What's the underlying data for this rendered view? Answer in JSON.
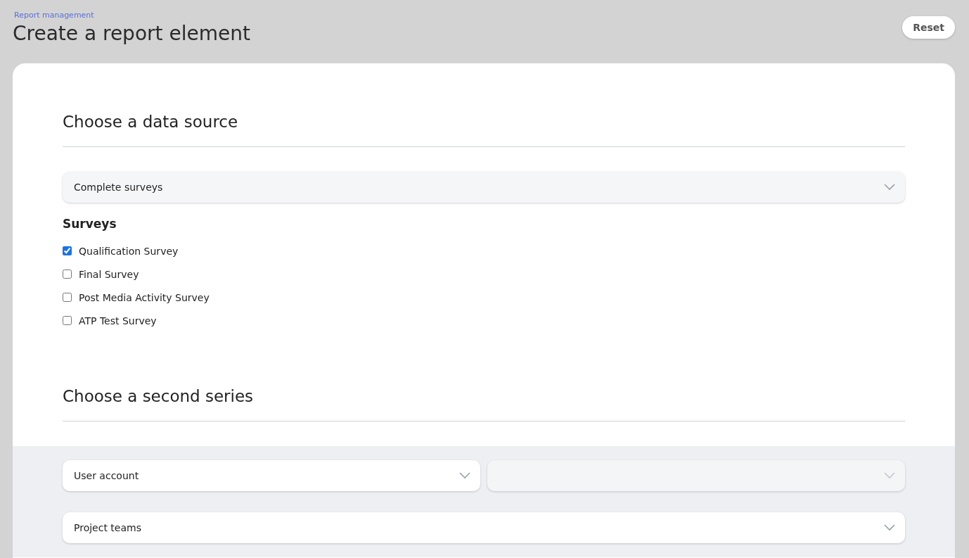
{
  "breadcrumb": "Report management",
  "title": "Create a report element",
  "reset_button": "Reset",
  "data_source": {
    "heading": "Choose a data source",
    "select": {
      "value": "Complete surveys"
    },
    "surveys_label": "Surveys",
    "surveys": [
      {
        "label": "Qualification Survey",
        "checked": true
      },
      {
        "label": "Final Survey",
        "checked": false
      },
      {
        "label": "Post Media Activity Survey",
        "checked": false
      },
      {
        "label": "ATP Test Survey",
        "checked": false
      }
    ]
  },
  "second_series": {
    "heading": "Choose a second series",
    "rows": [
      [
        {
          "value": "User account",
          "disabled": false
        },
        {
          "disabled": true
        }
      ],
      [
        {
          "value": "Project teams",
          "disabled": false
        }
      ]
    ]
  }
}
